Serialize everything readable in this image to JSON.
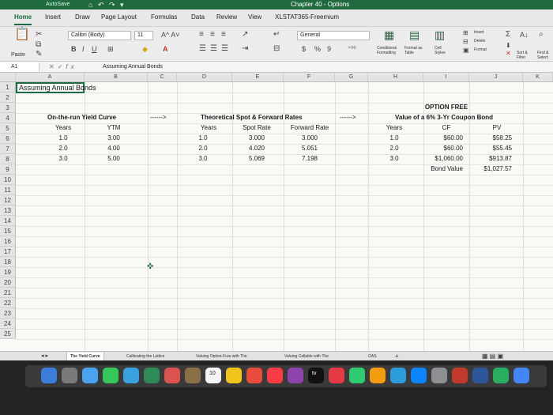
{
  "titlebar": {
    "quick_access": "AutoSave",
    "quick_icons": "⌂ ↶ ↷ ▾",
    "doc_title": "Chapter 40 - Options"
  },
  "tabs": [
    "Home",
    "Insert",
    "Draw",
    "Page Layout",
    "Formulas",
    "Data",
    "Review",
    "View",
    "XLSTAT365-Freemium"
  ],
  "ribbon": {
    "paste_label": "Paste",
    "font_name": "Calibri (Body)",
    "font_size": "11",
    "number_format": "General",
    "currency_btn": "$",
    "percent_btn": "%",
    "comma_btn": "9",
    "conditional_formatting": "Conditional Formatting",
    "format_as_table": "Format as Table",
    "cell_styles": "Cell Styles",
    "insert": "Insert",
    "delete": "Delete",
    "format": "Format",
    "sort_filter": "Sort & Filter",
    "find_select": "Find & Select"
  },
  "formula_bar": {
    "name_box": "A1",
    "formula": "Assuming Annual Bonds"
  },
  "columns": [
    "A",
    "B",
    "C",
    "D",
    "E",
    "F",
    "G",
    "H",
    "I",
    "J",
    "K"
  ],
  "rows": [
    "1",
    "2",
    "3",
    "4",
    "5",
    "6",
    "7",
    "8",
    "9",
    "10",
    "11",
    "12",
    "13",
    "14",
    "15",
    "16",
    "17",
    "18",
    "19",
    "20",
    "21",
    "22",
    "23",
    "24",
    "25"
  ],
  "cells": {
    "a1": "Assuming Annual Bonds",
    "yield_title": "On-the-run Yield Curve",
    "yield_years_hdr": "Years",
    "yield_ytm_hdr": "YTM",
    "yield_rows": [
      {
        "years": "1.0",
        "ytm": "3.00"
      },
      {
        "years": "2.0",
        "ytm": "4.00"
      },
      {
        "years": "3.0",
        "ytm": "5.00"
      }
    ],
    "arrow1": "------>",
    "spot_title": "Theoretical Spot & Forward Rates",
    "spot_years_hdr": "Years",
    "spot_rate_hdr": "Spot Rate",
    "fwd_rate_hdr": "Forward Rate",
    "spot_rows": [
      {
        "years": "1.0",
        "spot": "3.000",
        "fwd": "3.000"
      },
      {
        "years": "2.0",
        "spot": "4.020",
        "fwd": "5.051"
      },
      {
        "years": "3.0",
        "spot": "5.069",
        "fwd": "7.198"
      }
    ],
    "arrow2": "------>",
    "opt_title1": "OPTION FREE",
    "opt_title2": "Value of a 6% 3-Yr Coupon Bond",
    "opt_years_hdr": "Years",
    "opt_cf_hdr": "CF",
    "opt_pv_hdr": "PV",
    "opt_rows": [
      {
        "years": "1.0",
        "cf": "$60.00",
        "pv": "$58.25"
      },
      {
        "years": "2.0",
        "cf": "$60.00",
        "pv": "$55.45"
      },
      {
        "years": "3.0",
        "cf": "$1,060.00",
        "pv": "$913.87"
      }
    ],
    "bond_value_label": "Bond Value",
    "bond_value": "$1,027.57"
  },
  "sheet_tabs": [
    "The Yield Curve",
    "Calibrating the Lattice",
    "Valuing Option-Free with The",
    "Valuing Callable with The",
    "OAS",
    "+"
  ],
  "dock": {
    "calendar_day": "10",
    "tv_label": "tv"
  }
}
